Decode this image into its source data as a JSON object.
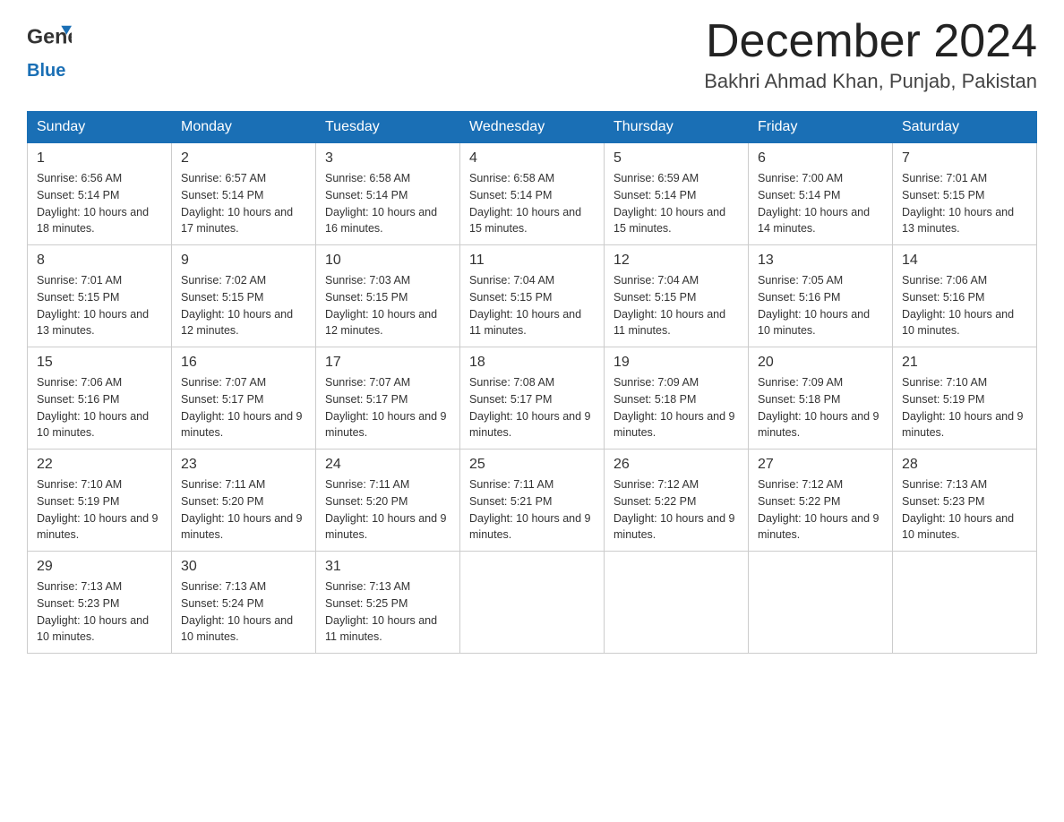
{
  "header": {
    "logo_general": "General",
    "logo_blue": "Blue",
    "month": "December 2024",
    "location": "Bakhri Ahmad Khan, Punjab, Pakistan"
  },
  "days_header": [
    "Sunday",
    "Monday",
    "Tuesday",
    "Wednesday",
    "Thursday",
    "Friday",
    "Saturday"
  ],
  "weeks": [
    [
      {
        "day": "1",
        "sunrise": "6:56 AM",
        "sunset": "5:14 PM",
        "daylight": "10 hours and 18 minutes."
      },
      {
        "day": "2",
        "sunrise": "6:57 AM",
        "sunset": "5:14 PM",
        "daylight": "10 hours and 17 minutes."
      },
      {
        "day": "3",
        "sunrise": "6:58 AM",
        "sunset": "5:14 PM",
        "daylight": "10 hours and 16 minutes."
      },
      {
        "day": "4",
        "sunrise": "6:58 AM",
        "sunset": "5:14 PM",
        "daylight": "10 hours and 15 minutes."
      },
      {
        "day": "5",
        "sunrise": "6:59 AM",
        "sunset": "5:14 PM",
        "daylight": "10 hours and 15 minutes."
      },
      {
        "day": "6",
        "sunrise": "7:00 AM",
        "sunset": "5:14 PM",
        "daylight": "10 hours and 14 minutes."
      },
      {
        "day": "7",
        "sunrise": "7:01 AM",
        "sunset": "5:15 PM",
        "daylight": "10 hours and 13 minutes."
      }
    ],
    [
      {
        "day": "8",
        "sunrise": "7:01 AM",
        "sunset": "5:15 PM",
        "daylight": "10 hours and 13 minutes."
      },
      {
        "day": "9",
        "sunrise": "7:02 AM",
        "sunset": "5:15 PM",
        "daylight": "10 hours and 12 minutes."
      },
      {
        "day": "10",
        "sunrise": "7:03 AM",
        "sunset": "5:15 PM",
        "daylight": "10 hours and 12 minutes."
      },
      {
        "day": "11",
        "sunrise": "7:04 AM",
        "sunset": "5:15 PM",
        "daylight": "10 hours and 11 minutes."
      },
      {
        "day": "12",
        "sunrise": "7:04 AM",
        "sunset": "5:15 PM",
        "daylight": "10 hours and 11 minutes."
      },
      {
        "day": "13",
        "sunrise": "7:05 AM",
        "sunset": "5:16 PM",
        "daylight": "10 hours and 10 minutes."
      },
      {
        "day": "14",
        "sunrise": "7:06 AM",
        "sunset": "5:16 PM",
        "daylight": "10 hours and 10 minutes."
      }
    ],
    [
      {
        "day": "15",
        "sunrise": "7:06 AM",
        "sunset": "5:16 PM",
        "daylight": "10 hours and 10 minutes."
      },
      {
        "day": "16",
        "sunrise": "7:07 AM",
        "sunset": "5:17 PM",
        "daylight": "10 hours and 9 minutes."
      },
      {
        "day": "17",
        "sunrise": "7:07 AM",
        "sunset": "5:17 PM",
        "daylight": "10 hours and 9 minutes."
      },
      {
        "day": "18",
        "sunrise": "7:08 AM",
        "sunset": "5:17 PM",
        "daylight": "10 hours and 9 minutes."
      },
      {
        "day": "19",
        "sunrise": "7:09 AM",
        "sunset": "5:18 PM",
        "daylight": "10 hours and 9 minutes."
      },
      {
        "day": "20",
        "sunrise": "7:09 AM",
        "sunset": "5:18 PM",
        "daylight": "10 hours and 9 minutes."
      },
      {
        "day": "21",
        "sunrise": "7:10 AM",
        "sunset": "5:19 PM",
        "daylight": "10 hours and 9 minutes."
      }
    ],
    [
      {
        "day": "22",
        "sunrise": "7:10 AM",
        "sunset": "5:19 PM",
        "daylight": "10 hours and 9 minutes."
      },
      {
        "day": "23",
        "sunrise": "7:11 AM",
        "sunset": "5:20 PM",
        "daylight": "10 hours and 9 minutes."
      },
      {
        "day": "24",
        "sunrise": "7:11 AM",
        "sunset": "5:20 PM",
        "daylight": "10 hours and 9 minutes."
      },
      {
        "day": "25",
        "sunrise": "7:11 AM",
        "sunset": "5:21 PM",
        "daylight": "10 hours and 9 minutes."
      },
      {
        "day": "26",
        "sunrise": "7:12 AM",
        "sunset": "5:22 PM",
        "daylight": "10 hours and 9 minutes."
      },
      {
        "day": "27",
        "sunrise": "7:12 AM",
        "sunset": "5:22 PM",
        "daylight": "10 hours and 9 minutes."
      },
      {
        "day": "28",
        "sunrise": "7:13 AM",
        "sunset": "5:23 PM",
        "daylight": "10 hours and 10 minutes."
      }
    ],
    [
      {
        "day": "29",
        "sunrise": "7:13 AM",
        "sunset": "5:23 PM",
        "daylight": "10 hours and 10 minutes."
      },
      {
        "day": "30",
        "sunrise": "7:13 AM",
        "sunset": "5:24 PM",
        "daylight": "10 hours and 10 minutes."
      },
      {
        "day": "31",
        "sunrise": "7:13 AM",
        "sunset": "5:25 PM",
        "daylight": "10 hours and 11 minutes."
      },
      null,
      null,
      null,
      null
    ]
  ],
  "cell_labels": {
    "sunrise": "Sunrise: ",
    "sunset": "Sunset: ",
    "daylight": "Daylight: "
  }
}
